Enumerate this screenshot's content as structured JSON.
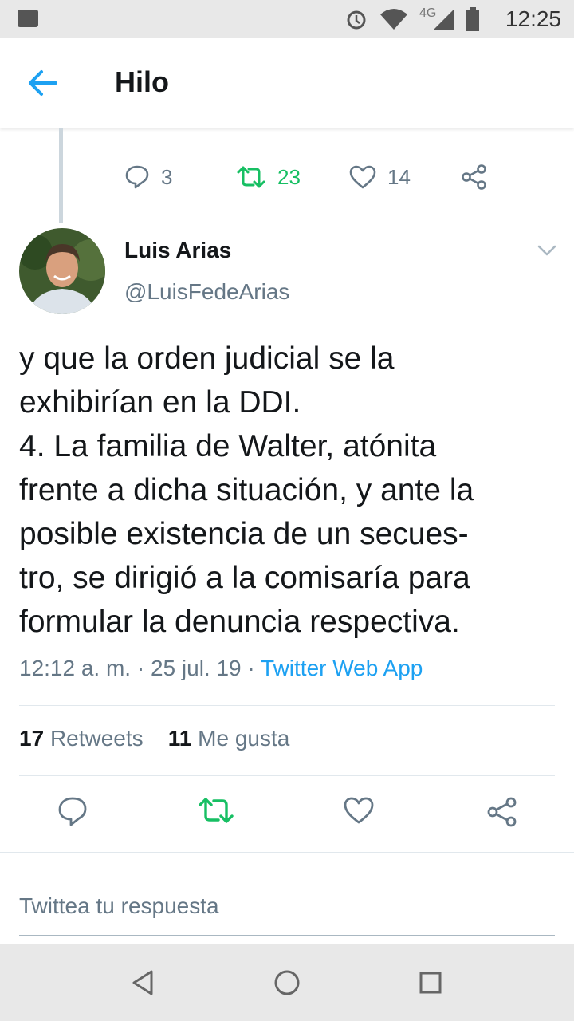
{
  "status_bar": {
    "time": "12:25",
    "network": "4G"
  },
  "app_bar": {
    "title": "Hilo"
  },
  "previous_tweet": {
    "replies": "3",
    "retweets": "23",
    "likes": "14"
  },
  "tweet": {
    "author_name": "Luis Arias",
    "author_handle": "@LuisFedeArias",
    "text": "y que la orden judicial se la\nexhibirían en la DDI.\n4. La familia de Walter, atónita\nfrente a dicha situación, y ante la\nposible existencia de un secues-\ntro, se dirigió a la comisaría para\nformular la denuncia respectiva.",
    "time": "12:12 a. m.",
    "date": "25 jul. 19",
    "separator": "·",
    "source": "Twitter Web App",
    "retweet_count": "17",
    "retweet_label": "Retweets",
    "like_count": "11",
    "like_label": "Me gusta"
  },
  "reply_box": {
    "placeholder": "Twittea tu respuesta"
  },
  "colors": {
    "accent": "#1da1f2",
    "retweet": "#17bf63",
    "secondary_text": "#657786"
  }
}
